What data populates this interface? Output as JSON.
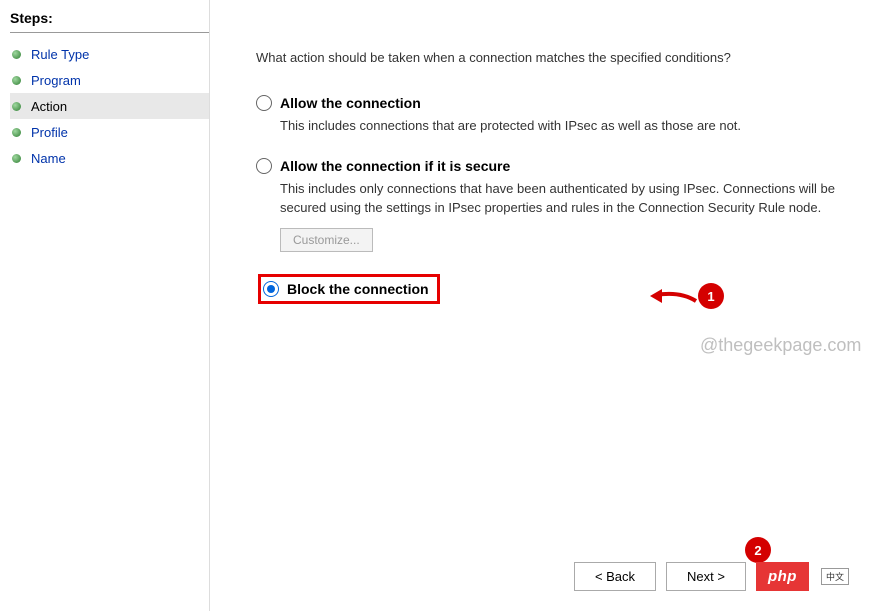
{
  "sidebar": {
    "title": "Steps:",
    "items": [
      {
        "label": "Rule Type",
        "active": false
      },
      {
        "label": "Program",
        "active": false
      },
      {
        "label": "Action",
        "active": true
      },
      {
        "label": "Profile",
        "active": false
      },
      {
        "label": "Name",
        "active": false
      }
    ]
  },
  "main": {
    "prompt": "What action should be taken when a connection matches the specified conditions?",
    "options": {
      "allow": {
        "title": "Allow the connection",
        "desc": "This includes connections that are protected with IPsec as well as those are not."
      },
      "allow_secure": {
        "title": "Allow the connection if it is secure",
        "desc": "This includes only connections that have been authenticated by using IPsec.  Connections will be secured using the settings in IPsec properties and rules in the Connection Security Rule node.",
        "customize": "Customize..."
      },
      "block": {
        "title": "Block the connection"
      }
    },
    "watermark": "@thegeekpage.com"
  },
  "annotations": {
    "marker1": "1",
    "marker2": "2"
  },
  "footer": {
    "back": "< Back",
    "next": "Next >",
    "badge": "php",
    "tag": "中文"
  }
}
